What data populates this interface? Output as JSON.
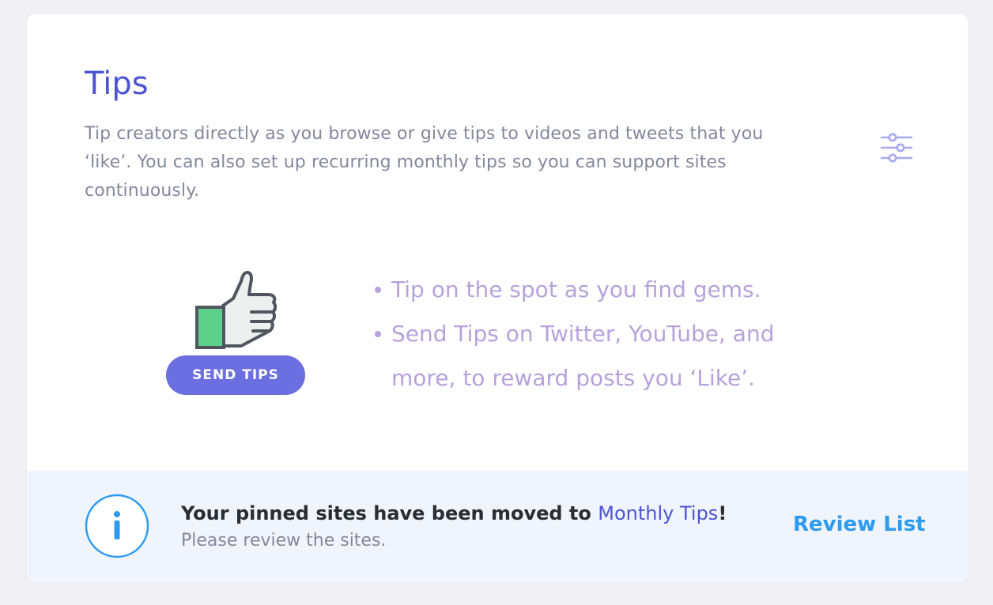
{
  "card": {
    "title": "Tips",
    "description": "Tip creators directly as you browse or give tips to videos and tweets that you ‘like’. You can also set up recurring monthly tips so you can support sites continuously.",
    "settings_icon": "sliders-icon"
  },
  "illustration": {
    "icon": "thumbs-up-icon",
    "button_label": "SEND TIPS"
  },
  "bullets": [
    "Tip on the spot as you find gems.",
    "Send Tips on Twitter, YouTube, and more, to reward posts you ‘Like’."
  ],
  "notice": {
    "icon": "info-icon",
    "message_prefix": "Your pinned sites have been moved to ",
    "message_link": "Monthly Tips",
    "message_suffix": "!",
    "subtext": "Please review the sites.",
    "action_label": "Review List"
  },
  "colors": {
    "page_bg": "#f1f1f5",
    "card_bg": "#ffffff",
    "title": "#4c54d2",
    "bullet_text": "#b7a2dc",
    "button_bg": "#6c6fe0",
    "notice_bg": "#f0f5fd",
    "action": "#2d9bf0",
    "thumb_green": "#5dcf8a"
  }
}
